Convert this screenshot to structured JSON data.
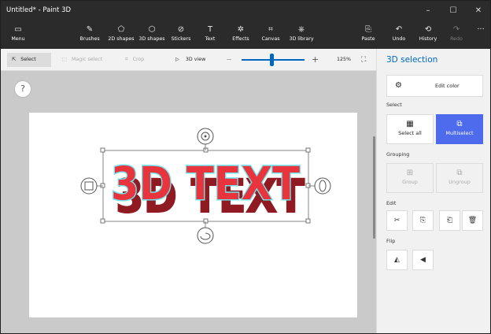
{
  "window": {
    "title": "Untitled* - Paint 3D",
    "minimize": "–",
    "maximize": "☐",
    "close": "✕"
  },
  "ribbon": {
    "items": [
      {
        "label": "Menu",
        "icon": "▭"
      },
      {
        "label": "Brushes",
        "icon": "✎"
      },
      {
        "label": "2D shapes",
        "icon": "⬠"
      },
      {
        "label": "3D shapes",
        "icon": "⬡"
      },
      {
        "label": "Stickers",
        "icon": "⊘"
      },
      {
        "label": "Text",
        "icon": "T"
      },
      {
        "label": "Effects",
        "icon": "✲"
      },
      {
        "label": "Canvas",
        "icon": "⌗"
      },
      {
        "label": "3D library",
        "icon": "⎈"
      },
      {
        "label": "Paste",
        "icon": "⎘"
      },
      {
        "label": "Undo",
        "icon": "↶"
      },
      {
        "label": "History",
        "icon": "⟲"
      },
      {
        "label": "Redo",
        "icon": "↷"
      },
      {
        "label": "",
        "icon": "···"
      }
    ]
  },
  "toolbar": {
    "select": "Select",
    "magic_select": "Magic select",
    "crop": "Crop",
    "view_3d": "3D view",
    "zoom_minus": "—",
    "zoom_plus": "+",
    "zoom_value": "125%",
    "zoom_level_percent": 55
  },
  "canvas": {
    "text": "3D TEXT"
  },
  "help": "?",
  "panel": {
    "title": "3D selection",
    "edit_color": "Edit color",
    "select_section": "Select",
    "select_all": "Select all",
    "multiselect": "Multiselect",
    "grouping_section": "Grouping",
    "group": "Group",
    "ungroup": "Ungroup",
    "edit_section": "Edit",
    "flip_section": "Flip"
  },
  "colors": {
    "accent": "#0067c0",
    "multiselect_bg": "#4f6bed",
    "text_fill": "#e8343d",
    "text_outline": "#6fe6f0"
  }
}
